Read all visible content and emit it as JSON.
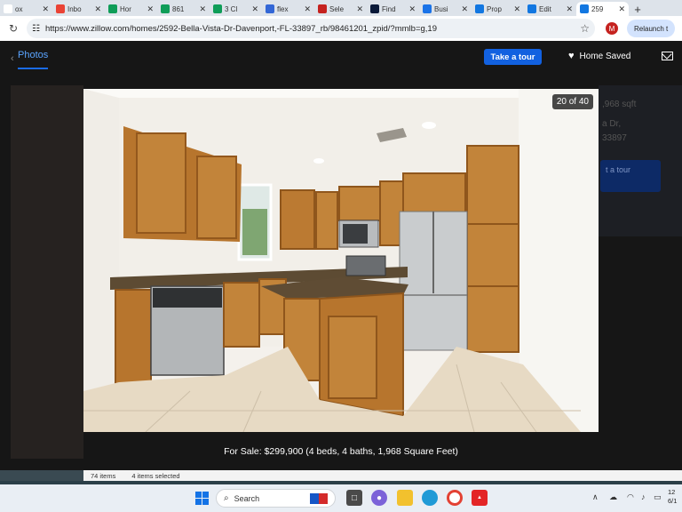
{
  "tabs": [
    {
      "label": "ox",
      "icon": "tab-favicon",
      "color": "#fff"
    },
    {
      "label": "Inbo",
      "icon": "gmail-icon",
      "color": "#ea4335"
    },
    {
      "label": "Hor",
      "icon": "drive-icon",
      "color": "#0f9d58"
    },
    {
      "label": "861",
      "icon": "sheets-icon",
      "color": "#0f9d58"
    },
    {
      "label": "3 Cl",
      "icon": "sheets-icon",
      "color": "#0f9d58"
    },
    {
      "label": "flex",
      "icon": "flex-icon",
      "color": "#3367d6"
    },
    {
      "label": "Sele",
      "icon": "select-icon",
      "color": "#c5221f"
    },
    {
      "label": "Find",
      "icon": "find-icon",
      "color": "#0b1a3a"
    },
    {
      "label": "Busi",
      "icon": "business-icon",
      "color": "#1a73e8"
    },
    {
      "label": "Prop",
      "icon": "zillow-icon",
      "color": "#1277e1"
    },
    {
      "label": "Edit",
      "icon": "zillow-icon",
      "color": "#1277e1"
    },
    {
      "label": "259",
      "icon": "zillow-icon",
      "color": "#1277e1",
      "active": true
    }
  ],
  "address": {
    "url": "https://www.zillow.com/homes/2592-Bella-Vista-Dr-Davenport,-FL-33897_rb/98461201_zpid/?mmlb=g,19",
    "profile_initial": "M",
    "relaunch": "Relaunch t"
  },
  "page": {
    "photos_tab": "Photos",
    "take_tour": "Take a tour",
    "home_saved": "Home Saved",
    "counter": "20 of 40",
    "caption": "For Sale: $299,900 (4 beds, 4 baths, 1,968 Square Feet)",
    "bg_sqft": ",968 sqft",
    "bg_street": "a Dr,",
    "bg_zip": "33897",
    "bg_tour": "t a tour"
  },
  "explorer": {
    "items": "74 items",
    "selected": "4 items selected"
  },
  "taskbar": {
    "search_placeholder": "Search",
    "clock_time": "12",
    "clock_date": "6/1"
  },
  "colors": {
    "accent": "#1261e0",
    "tab_active": "#ffffff"
  }
}
